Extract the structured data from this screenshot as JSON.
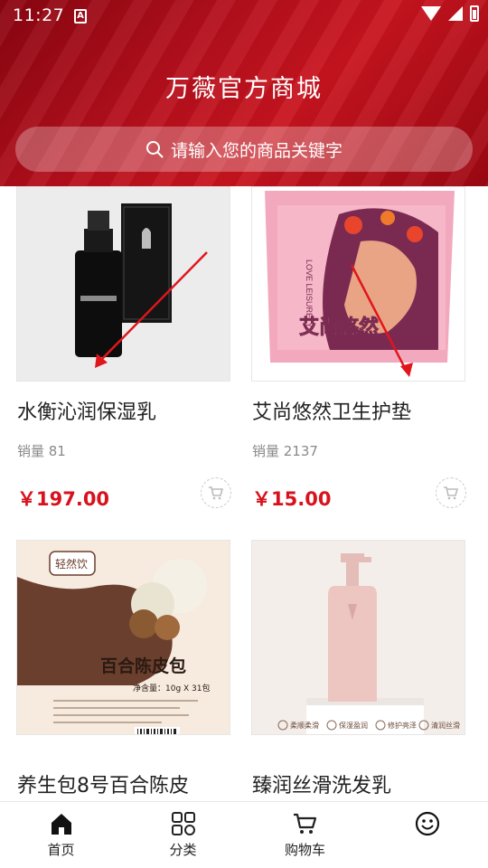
{
  "status_bar": {
    "time": "11:27",
    "sim": "A"
  },
  "header": {
    "title": "万薇官方商城"
  },
  "search": {
    "placeholder": "请输入您的商品关键字"
  },
  "products": [
    {
      "name": "水衡沁润保湿乳",
      "sales": "销量 81",
      "price": "￥197.00"
    },
    {
      "name": "艾尚悠然卫生护垫",
      "sales": "销量 2137",
      "price": "￥15.00"
    },
    {
      "name": "养生包8号百合陈皮",
      "sales": "",
      "price": ""
    },
    {
      "name": "臻润丝滑洗发乳",
      "sales": "",
      "price": ""
    }
  ],
  "product_images": {
    "p2_text_vertical": "LOVE LEISURELY",
    "p2_brand": "艾尚悠然",
    "p3_brand": "轻然饮",
    "p3_title": "百合陈皮包",
    "p3_spec": "净含量：10g X 31包",
    "p4_features": [
      "柔顺柔滑",
      "保湿盈润",
      "修护亮泽",
      "清润丝滑"
    ]
  },
  "bottom_nav": [
    {
      "label": "首页",
      "icon": "home-icon"
    },
    {
      "label": "分类",
      "icon": "category-icon"
    },
    {
      "label": "购物车",
      "icon": "cart-icon"
    },
    {
      "label": "",
      "icon": "profile-face-icon"
    }
  ],
  "colors": {
    "header_red": "#b40f1c",
    "price_red": "#d8121c",
    "annotation_arrow": "#e0161c"
  }
}
